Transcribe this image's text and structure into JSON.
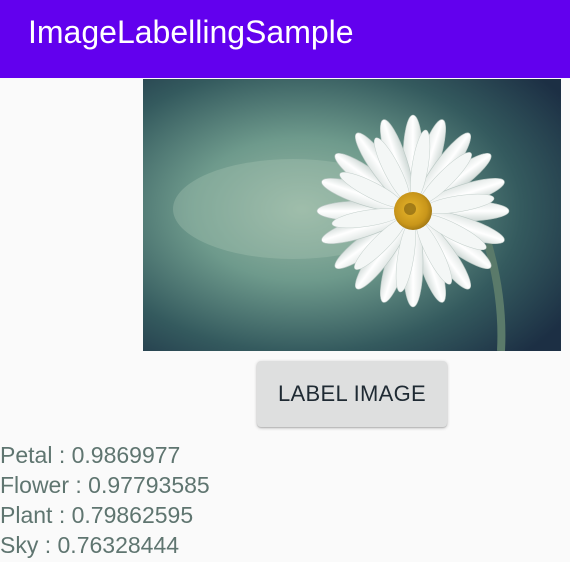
{
  "app_bar": {
    "title": "ImageLabellingSample",
    "color": "#6200ee"
  },
  "image": {
    "subject": "white daisy flower on teal background"
  },
  "action_button": {
    "label": "LABEL IMAGE"
  },
  "results": [
    {
      "label": "Petal",
      "confidence": "0.9869977",
      "text": "Petal : 0.9869977"
    },
    {
      "label": "Flower",
      "confidence": "0.97793585",
      "text": "Flower : 0.97793585"
    },
    {
      "label": "Plant",
      "confidence": "0.79862595",
      "text": "Plant : 0.79862595"
    },
    {
      "label": "Sky",
      "confidence": "0.76328444",
      "text": "Sky : 0.76328444"
    }
  ]
}
